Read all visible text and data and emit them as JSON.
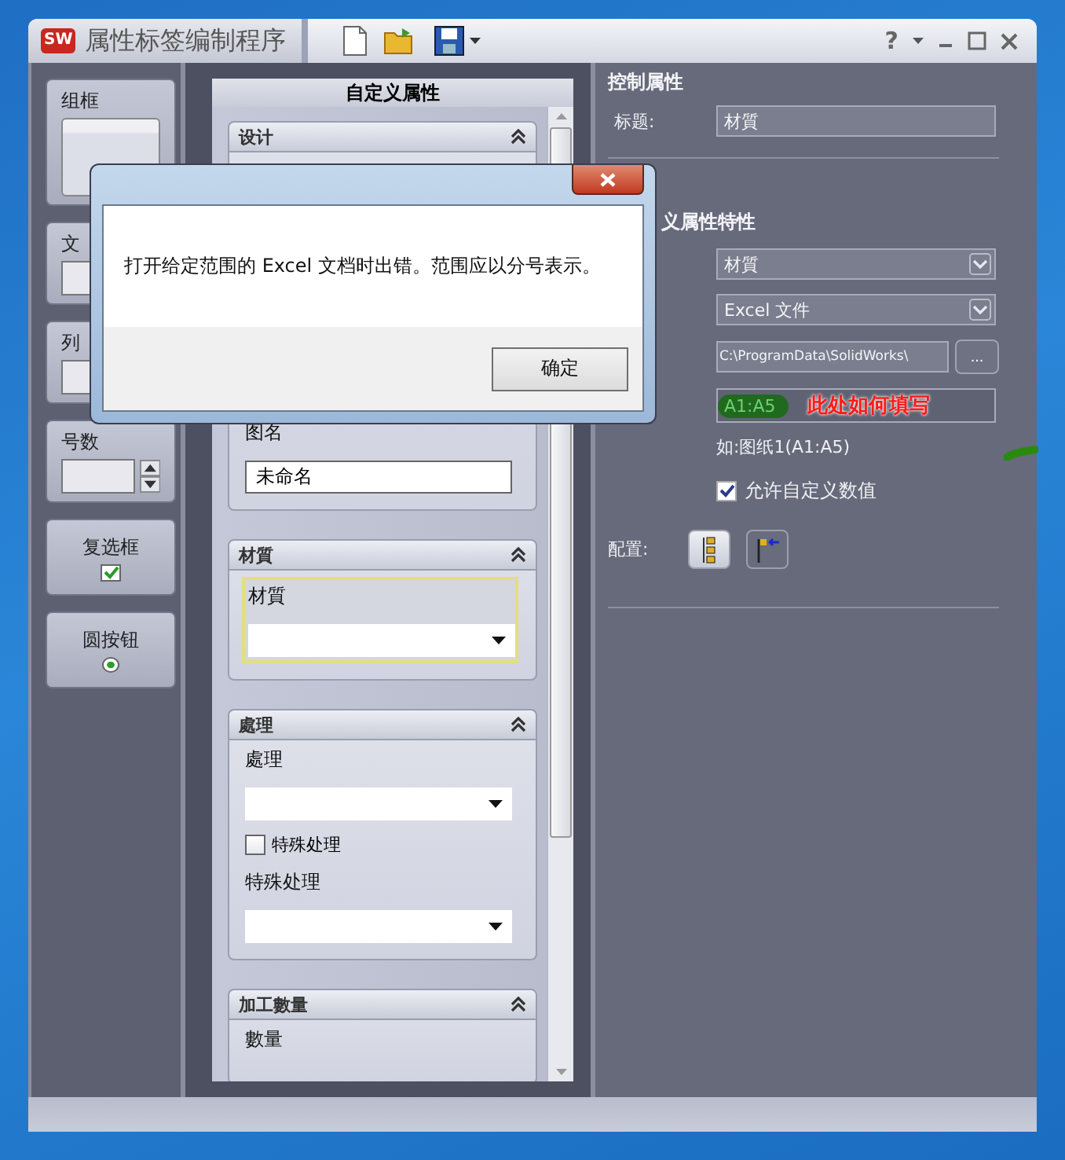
{
  "window": {
    "logo": "SW",
    "title": "属性标签编制程序",
    "help": "?"
  },
  "palette": [
    {
      "kind": "groupbox",
      "label": "组框"
    },
    {
      "kind": "textbox",
      "label": "文"
    },
    {
      "kind": "list",
      "label": "列"
    },
    {
      "kind": "spinner",
      "label": "号数"
    },
    {
      "kind": "checkbox",
      "label": "复选框",
      "checked": true
    },
    {
      "kind": "radio",
      "label": "圆按钮",
      "selected": true
    }
  ],
  "custom_properties": {
    "title": "自定义属性",
    "groups": [
      {
        "title": "设计",
        "fields": [
          {
            "kind": "text",
            "label": "图名",
            "value": "未命名",
            "focused": false
          }
        ]
      },
      {
        "title": "材質",
        "fields": [
          {
            "kind": "dropdown",
            "label": "材質",
            "focused": true
          }
        ]
      },
      {
        "title": "處理",
        "fields": [
          {
            "kind": "dropdown",
            "label": "處理",
            "focused": false
          },
          {
            "kind": "checkbox",
            "label": "特殊处理",
            "checked": false,
            "focused": false
          },
          {
            "kind": "dropdown",
            "label": "特殊处理",
            "focused": false
          }
        ]
      },
      {
        "title": "加工數量",
        "fields": [
          {
            "kind": "label",
            "label": "數量",
            "focused": false
          }
        ]
      }
    ]
  },
  "control_properties": {
    "title": "控制属性",
    "caption_label": "标题:",
    "caption_value": "材質"
  },
  "property_settings": {
    "title": "义属性特性",
    "property_name": "材質",
    "source": "Excel 文件",
    "file_path": "C:\\ProgramData\\SolidWorks\\",
    "browse": "...",
    "range": "A1:A5",
    "annotation": "此处如何填写",
    "range_hint": "如:图纸1(A1:A5)",
    "allow_custom": {
      "label": "允许自定义数值",
      "checked": true
    },
    "config_label": "配置:",
    "config_buttons": [
      {
        "kind": "tree",
        "selected": true
      },
      {
        "kind": "flag",
        "selected": false
      }
    ]
  },
  "dialog": {
    "message": "打开给定范围的 Excel 文档时出错。范围应以分号表示。",
    "ok": "确定"
  }
}
